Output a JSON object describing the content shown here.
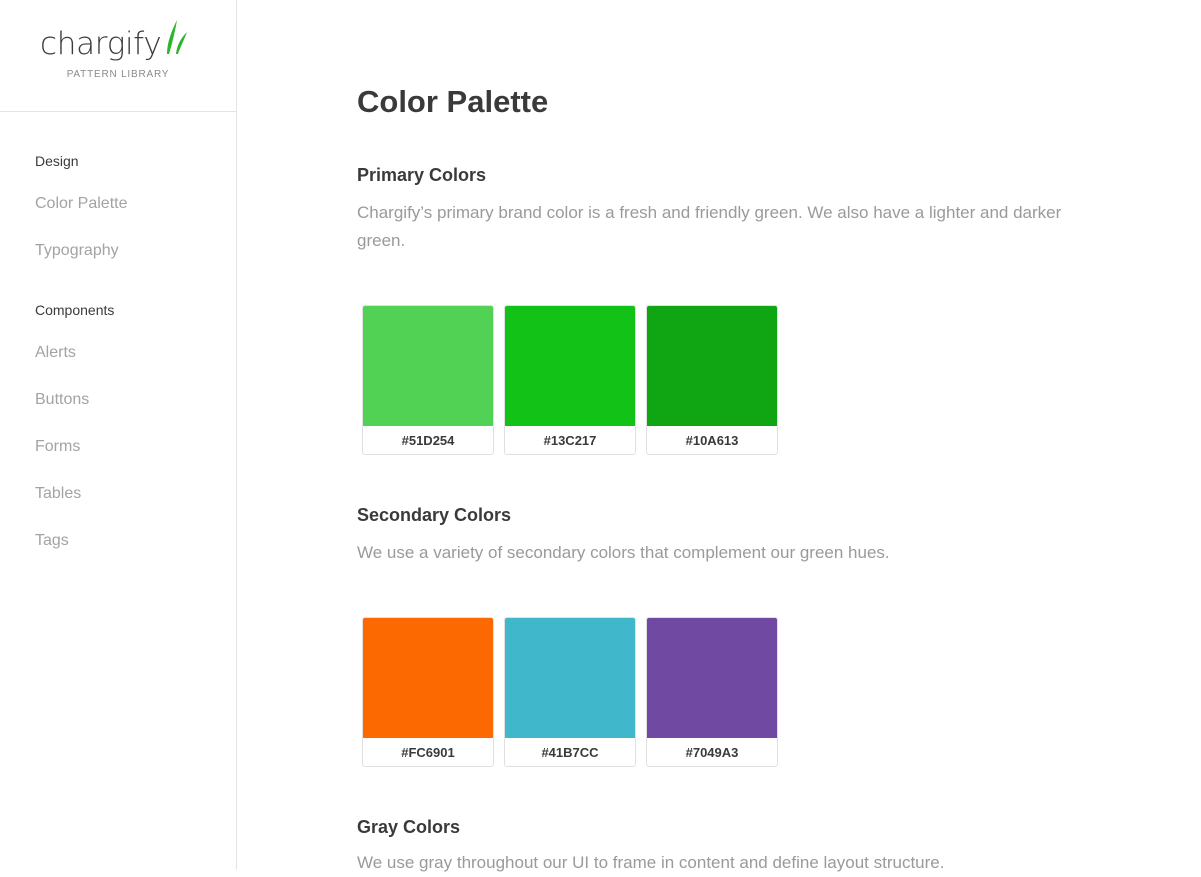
{
  "brand": {
    "name": "chargify",
    "subtitle": "PATTERN LIBRARY",
    "accent": "#2bb52b"
  },
  "sidebar": {
    "sections": [
      {
        "heading": "Design",
        "items": [
          "Color Palette",
          "Typography"
        ]
      },
      {
        "heading": "Components",
        "items": [
          "Alerts",
          "Buttons",
          "Forms",
          "Tables",
          "Tags"
        ]
      }
    ]
  },
  "page": {
    "title": "Color Palette"
  },
  "sections": [
    {
      "title": "Primary Colors",
      "description": "Chargify’s primary brand color is a fresh and friendly green. We also have a lighter and darker green.",
      "swatches": [
        {
          "hex": "#51D254",
          "color": "#51D254"
        },
        {
          "hex": "#13C217",
          "color": "#13C217"
        },
        {
          "hex": "#10A613",
          "color": "#10A613"
        }
      ]
    },
    {
      "title": "Secondary Colors",
      "description": "We use a variety of secondary colors that complement our green hues.",
      "swatches": [
        {
          "hex": "#FC6901",
          "color": "#FC6901"
        },
        {
          "hex": "#41B7CC",
          "color": "#41B7CC"
        },
        {
          "hex": "#7049A3",
          "color": "#7049A3"
        }
      ]
    },
    {
      "title": "Gray Colors",
      "description": "We use gray throughout our UI to frame in content and define layout structure."
    }
  ]
}
